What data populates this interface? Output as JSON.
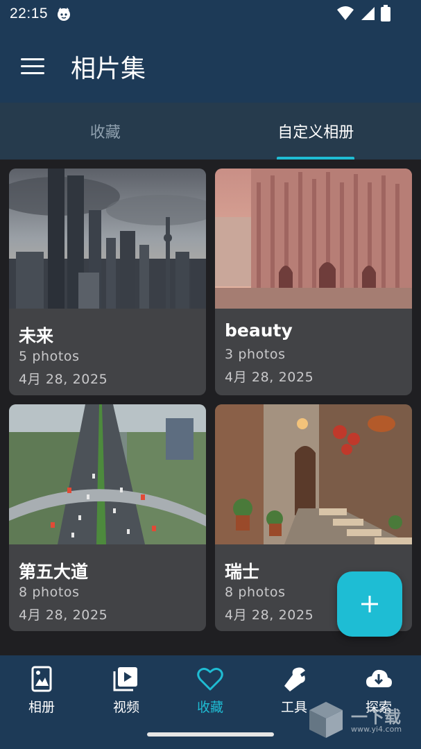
{
  "status_bar": {
    "time": "22:15"
  },
  "app_bar": {
    "title": "相片集"
  },
  "tabs": [
    {
      "label": "收藏",
      "active": false
    },
    {
      "label": "自定义相册",
      "active": true
    }
  ],
  "albums": [
    {
      "title": "未来",
      "count": "5 photos",
      "date": "4月 28, 2025"
    },
    {
      "title": "beauty",
      "count": "3 photos",
      "date": "4月 28, 2025"
    },
    {
      "title": "第五大道",
      "count": "8 photos",
      "date": "4月 28, 2025"
    },
    {
      "title": "瑞士",
      "count": "8 photos",
      "date": "4月 28, 2025"
    }
  ],
  "bottom_nav": [
    {
      "label": "相册",
      "icon": "album-icon"
    },
    {
      "label": "视频",
      "icon": "video-icon"
    },
    {
      "label": "收藏",
      "icon": "heart-icon",
      "active": true
    },
    {
      "label": "工具",
      "icon": "wrench-icon"
    },
    {
      "label": "探索",
      "icon": "cloud-download-icon"
    }
  ],
  "watermark": {
    "text": "一下载",
    "url": "www.yi4.com"
  },
  "colors": {
    "header": "#1d3a57",
    "tabs": "#263b4d",
    "accent": "#1fbcd3",
    "card": "#424346",
    "background": "#1f1f22"
  }
}
